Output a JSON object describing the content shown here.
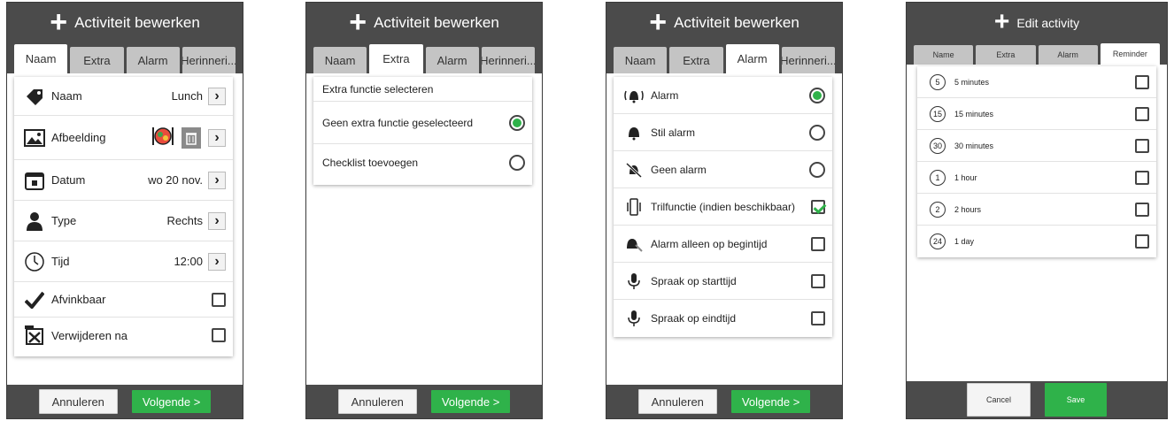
{
  "screen1": {
    "title": "Activiteit bewerken",
    "tabs": [
      "Naam",
      "Extra",
      "Alarm",
      "Herinneri..."
    ],
    "active_tab": 0,
    "rows": {
      "name_label": "Naam",
      "name_value": "Lunch",
      "image_label": "Afbeelding",
      "date_label": "Datum",
      "date_value": "wo 20 nov.",
      "type_label": "Type",
      "type_value": "Rechts",
      "time_label": "Tijd",
      "time_value": "12:00",
      "checkable_label": "Afvinkbaar",
      "delete_label": "Verwijderen na"
    },
    "cancel": "Annuleren",
    "next": "Volgende >"
  },
  "screen2": {
    "title": "Activiteit bewerken",
    "tabs": [
      "Naam",
      "Extra",
      "Alarm",
      "Herinneri..."
    ],
    "active_tab": 1,
    "header": "Extra functie selecteren",
    "options": [
      "Geen extra functie geselecteerd",
      "Checklist toevoegen"
    ],
    "cancel": "Annuleren",
    "next": "Volgende >"
  },
  "screen3": {
    "title": "Activiteit bewerken",
    "tabs": [
      "Naam",
      "Extra",
      "Alarm",
      "Herinneri..."
    ],
    "active_tab": 2,
    "alarm_options": [
      "Alarm",
      "Stil alarm",
      "Geen alarm"
    ],
    "extra_options": [
      "Trilfunctie (indien beschikbaar)",
      "Alarm alleen op begintijd",
      "Spraak op starttijd",
      "Spraak op eindtijd"
    ],
    "cancel": "Annuleren",
    "next": "Volgende >"
  },
  "screen4": {
    "title": "Edit activity",
    "tabs": [
      "Name",
      "Extra",
      "Alarm",
      "Reminder"
    ],
    "active_tab": 3,
    "reminders": [
      {
        "num": "5",
        "label": "5 minutes"
      },
      {
        "num": "15",
        "label": "15 minutes"
      },
      {
        "num": "30",
        "label": "30 minutes"
      },
      {
        "num": "1",
        "label": "1 hour"
      },
      {
        "num": "2",
        "label": "2 hours"
      },
      {
        "num": "24",
        "label": "1 day"
      }
    ],
    "cancel": "Cancel",
    "save": "Save"
  },
  "colors": {
    "bar": "#4b4b4b",
    "accent_green": "#2fb24a",
    "tab_inactive": "#c4c4c4"
  }
}
